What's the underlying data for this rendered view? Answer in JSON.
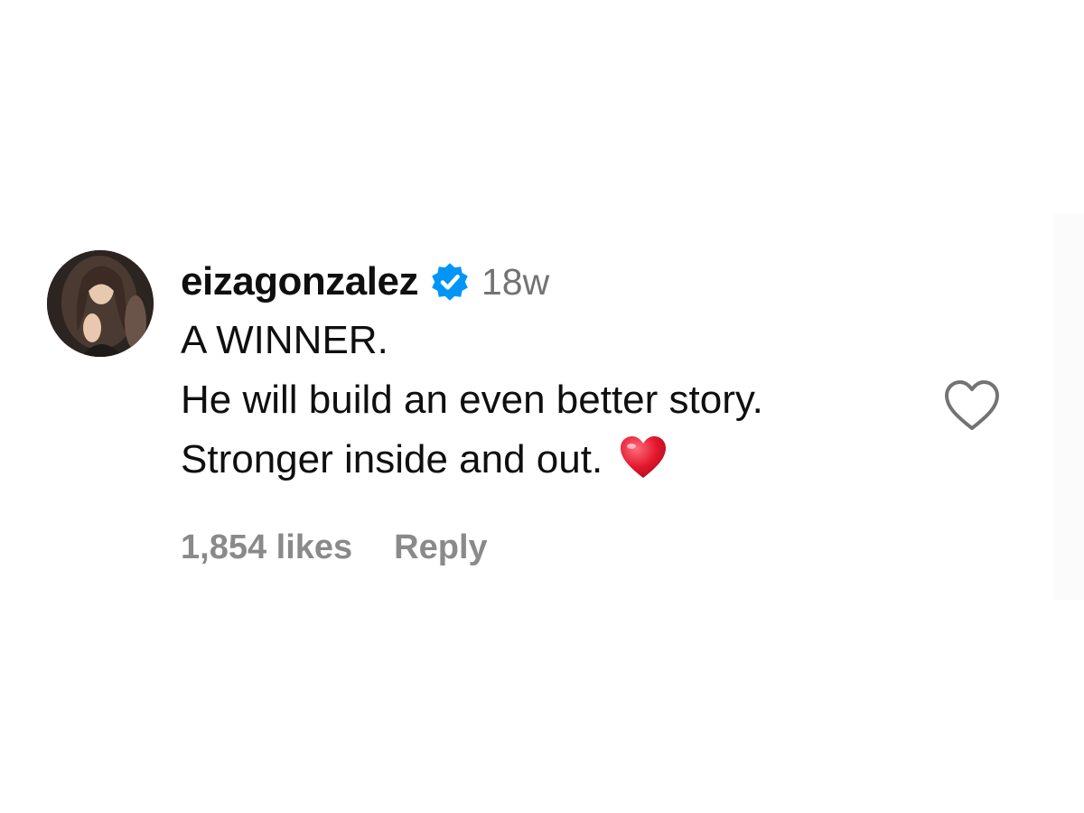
{
  "comment": {
    "username": "eizagonzalez",
    "verified_icon": "verified-badge-icon",
    "timestamp": "18w",
    "text_lines": [
      "A WINNER.",
      "He will build an even better story.",
      "Stronger inside and out."
    ],
    "text_emoji": "red-heart-emoji",
    "likes": "1,854 likes",
    "reply_label": "Reply",
    "like_icon": "heart-outline-icon",
    "avatar_alt": "avatar"
  },
  "colors": {
    "text": "#0f0f0f",
    "muted": "#737373",
    "verified": "#0095f6",
    "heart": "#e0245e"
  }
}
